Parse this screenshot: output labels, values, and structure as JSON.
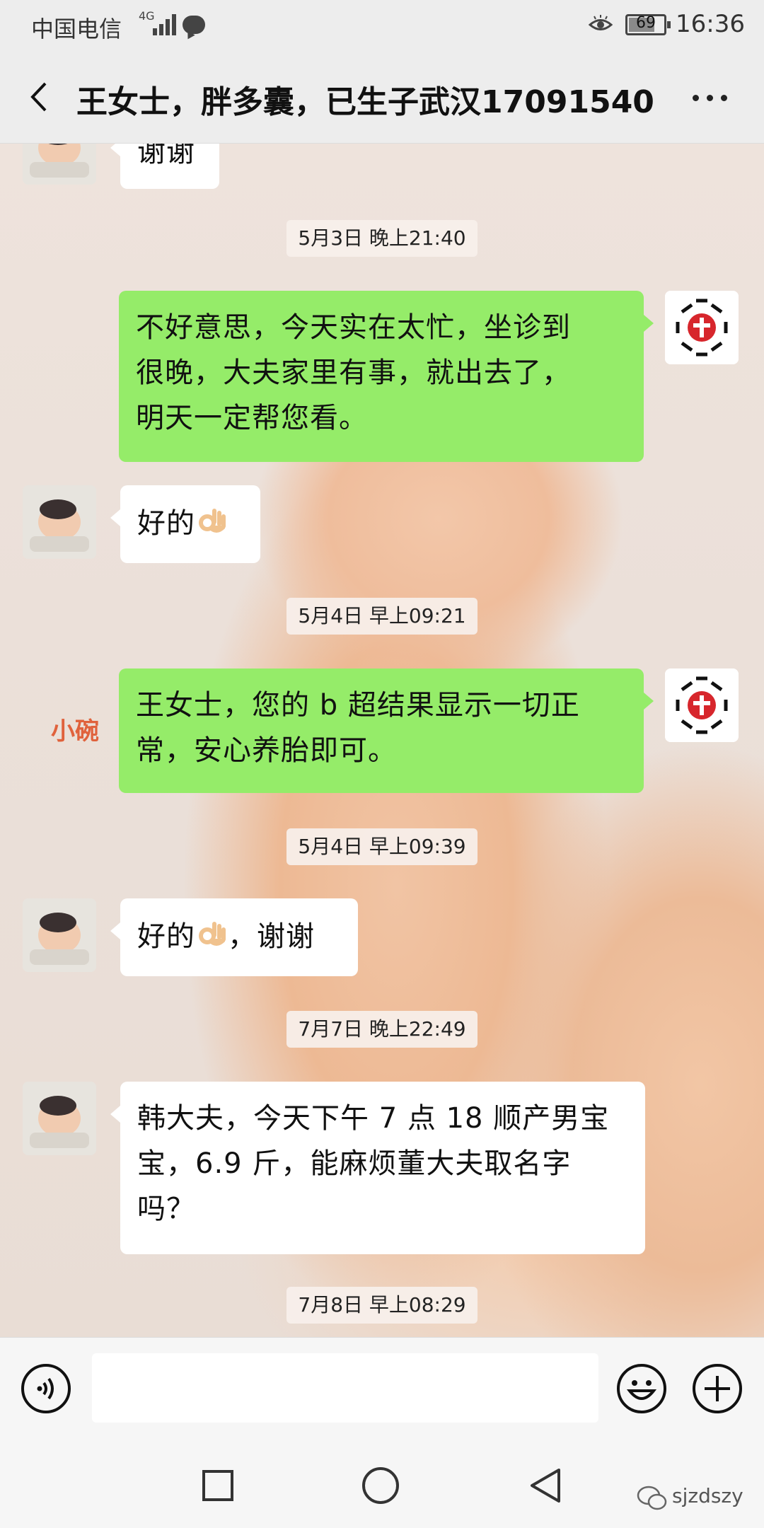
{
  "status_bar": {
    "carrier": "中国电信",
    "network": "4G",
    "battery": "69",
    "time": "16:36"
  },
  "header": {
    "title": "王女士，胖多囊，已生子武汉17091540"
  },
  "chat": {
    "watermark": "小碗",
    "partial_message": "谢谢",
    "timestamps": [
      "5月3日 晚上21:40",
      "5月4日 早上09:21",
      "5月4日 早上09:39",
      "7月7日 晚上22:49",
      "7月8日 早上08:29"
    ],
    "messages": [
      {
        "side": "out",
        "lines": [
          "不好意思，今天实在太忙，坐诊到",
          "很晚，大夫家里有事，就出去了，",
          "明天一定帮您看。"
        ]
      },
      {
        "side": "in",
        "text": "好的"
      },
      {
        "side": "out",
        "lines": [
          "王女士，您的 b 超结果显示一切正",
          "常，安心养胎即可。"
        ]
      },
      {
        "side": "in",
        "text_before": "好的",
        "text_after": "，谢谢"
      },
      {
        "side": "in",
        "lines": [
          "韩大夫，今天下午 7 点 18 顺产男宝",
          "宝，6.9 斤，能麻烦董大夫取名字",
          "吗？"
        ]
      }
    ]
  },
  "input_bar": {
    "placeholder": ""
  },
  "nav_watermark": "sjzdszy",
  "colors": {
    "outgoing_bubble": "#95ec69",
    "incoming_bubble": "#ffffff",
    "header_bg": "#ededed",
    "watermark_orange": "#e0623c"
  },
  "icons": [
    "back-icon",
    "more-icon",
    "voice-icon",
    "emoji-icon",
    "plus-icon",
    "ok-hand-emoji",
    "hospital-logo-icon"
  ]
}
